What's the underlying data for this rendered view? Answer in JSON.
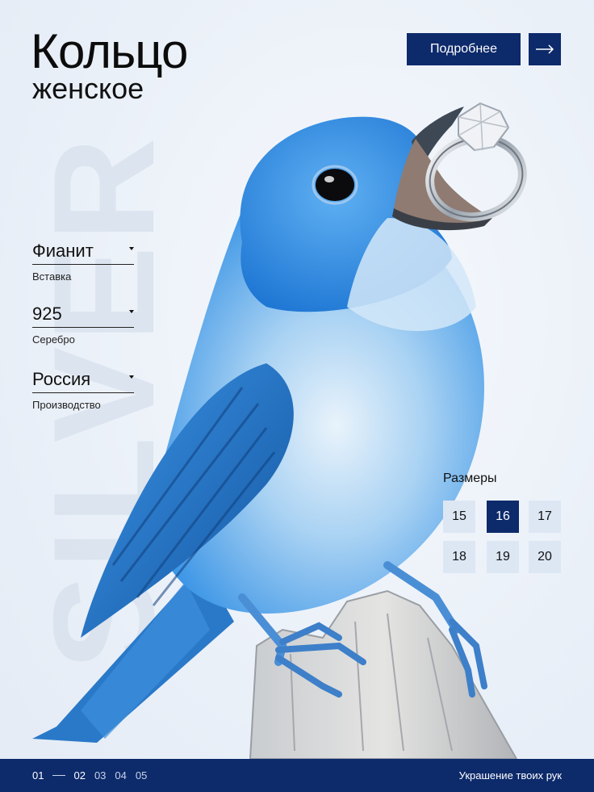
{
  "header": {
    "title": "Кольцо",
    "subtitle": "женское",
    "more_button": "Подробнее"
  },
  "watermark": "SILVER",
  "specs": [
    {
      "value": "Фианит",
      "label": "Вставка"
    },
    {
      "value": "925",
      "label": "Серебро"
    },
    {
      "value": "Россия",
      "label": "Производство"
    }
  ],
  "sizes": {
    "title": "Размеры",
    "options": [
      "15",
      "16",
      "17",
      "18",
      "19",
      "20"
    ],
    "selected": "16"
  },
  "footer": {
    "pages": [
      "01",
      "02",
      "03",
      "04",
      "05"
    ],
    "current_page": "01",
    "tagline": "Украшение твоих рук"
  },
  "colors": {
    "accent": "#0d2a6b",
    "size_bg": "#dde7f4",
    "bird_blue": "#2f8fe6",
    "bird_light": "#cfe4f7"
  },
  "icons": {
    "more_arrow": "arrow-right-icon",
    "dropdown": "caret-down-icon"
  }
}
